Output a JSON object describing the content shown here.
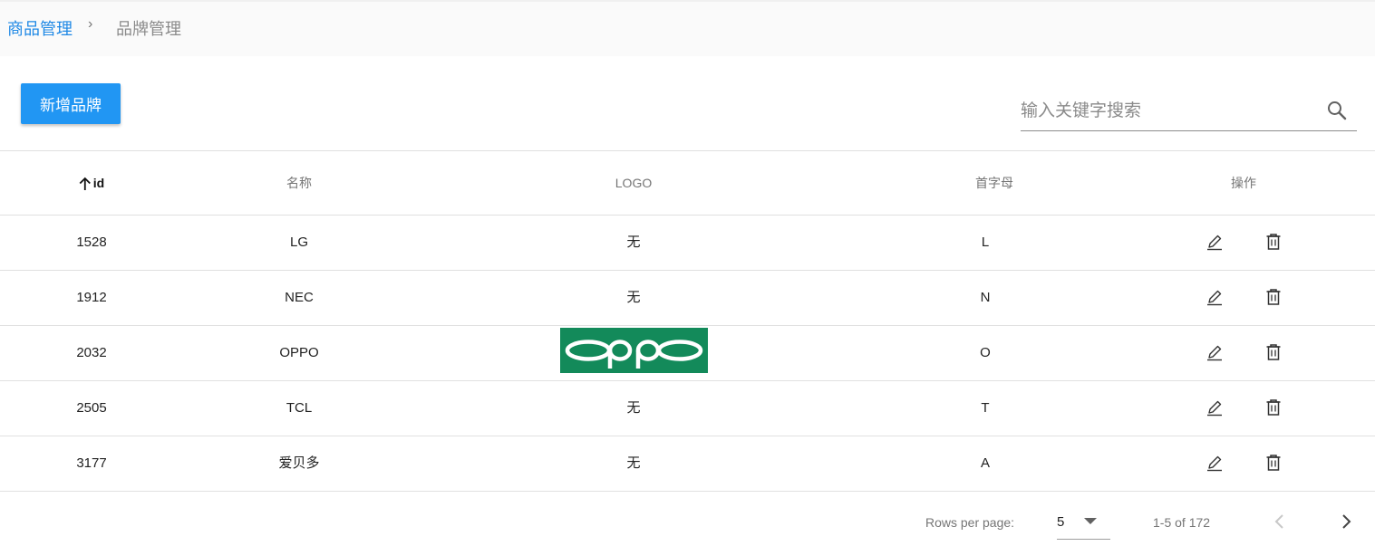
{
  "breadcrumb": {
    "parent": "商品管理",
    "separator": "›",
    "current": "品牌管理"
  },
  "toolbar": {
    "add_label": "新增品牌"
  },
  "search": {
    "placeholder": "输入关键字搜索",
    "value": "",
    "icon": "search-icon"
  },
  "table": {
    "headers": {
      "id": "id",
      "name": "名称",
      "logo": "LOGO",
      "letter": "首字母",
      "actions": "操作"
    },
    "sort": {
      "column": "id",
      "direction": "ascending",
      "icon": "arrow-up-icon"
    },
    "rows": [
      {
        "id": "1528",
        "name": "LG",
        "logo": "无",
        "letter": "L"
      },
      {
        "id": "1912",
        "name": "NEC",
        "logo": "无",
        "letter": "N"
      },
      {
        "id": "2032",
        "name": "OPPO",
        "logo": "oppo",
        "letter": "O"
      },
      {
        "id": "2505",
        "name": "TCL",
        "logo": "无",
        "letter": "T"
      },
      {
        "id": "3177",
        "name": "爱贝多",
        "logo": "无",
        "letter": "A"
      }
    ],
    "row_actions": [
      "edit-icon",
      "delete-icon"
    ]
  },
  "pagination": {
    "rows_per_page_label": "Rows per page:",
    "rows_per_page": "5",
    "range": "1-5 of 172",
    "prev_icon": "chevron-left-icon",
    "next_icon": "chevron-right-icon"
  },
  "colors": {
    "primary": "#2196f3",
    "breadcrumb_link": "#1e88e5",
    "oppo_logo_bg": "#138a5a"
  }
}
